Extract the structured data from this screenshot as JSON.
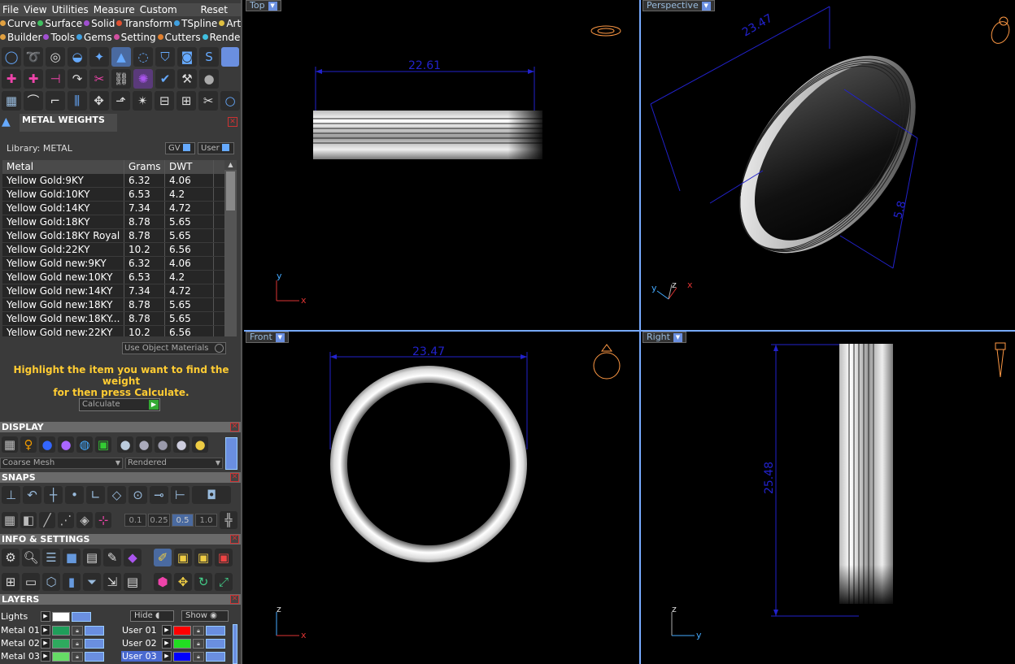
{
  "menu": {
    "file": "File",
    "view": "View",
    "utilities": "Utilities",
    "measure": "Measure",
    "custom": "Custom",
    "reset": "Reset"
  },
  "categories_row1": [
    {
      "label": "Curve",
      "color": "#e0a040"
    },
    {
      "label": "Surface",
      "color": "#40c060"
    },
    {
      "label": "Solid",
      "color": "#a050d0"
    },
    {
      "label": "Transform",
      "color": "#e05030"
    },
    {
      "label": "TSpline",
      "color": "#40a0e0"
    },
    {
      "label": "Art",
      "color": "#e0c040"
    }
  ],
  "categories_row2": [
    {
      "label": "Builder",
      "color": "#e0a040"
    },
    {
      "label": "Tools",
      "color": "#a050d0"
    },
    {
      "label": "Gems",
      "color": "#40a0e0"
    },
    {
      "label": "Setting",
      "color": "#d050a0"
    },
    {
      "label": "Cutters",
      "color": "#e08030"
    },
    {
      "label": "Render",
      "color": "#40c0e0"
    }
  ],
  "metal_weights": {
    "title": "METAL WEIGHTS",
    "library_label": "Library: METAL",
    "gv_label": "GV",
    "user_label": "User",
    "columns": [
      "Metal",
      "Grams",
      "DWT"
    ],
    "rows": [
      {
        "metal": "Yellow Gold:9KY",
        "grams": "6.32",
        "dwt": "4.06"
      },
      {
        "metal": "Yellow Gold:10KY",
        "grams": "6.53",
        "dwt": "4.2"
      },
      {
        "metal": "Yellow Gold:14KY",
        "grams": "7.34",
        "dwt": "4.72"
      },
      {
        "metal": "Yellow Gold:18KY",
        "grams": "8.78",
        "dwt": "5.65"
      },
      {
        "metal": "Yellow Gold:18KY Royal",
        "grams": "8.78",
        "dwt": "5.65"
      },
      {
        "metal": "Yellow Gold:22KY",
        "grams": "10.2",
        "dwt": "6.56"
      },
      {
        "metal": "Yellow Gold new:9KY",
        "grams": "6.32",
        "dwt": "4.06"
      },
      {
        "metal": "Yellow Gold new:10KY",
        "grams": "6.53",
        "dwt": "4.2"
      },
      {
        "metal": "Yellow Gold new:14KY",
        "grams": "7.34",
        "dwt": "4.72"
      },
      {
        "metal": "Yellow Gold new:18KY",
        "grams": "8.78",
        "dwt": "5.65"
      },
      {
        "metal": "Yellow Gold new:18KY...",
        "grams": "8.78",
        "dwt": "5.65"
      },
      {
        "metal": "Yellow Gold new:22KY",
        "grams": "10.2",
        "dwt": "6.56"
      }
    ],
    "use_object_materials": "Use Object Materials",
    "hint_line1": "Highlight the item you want to find the weight",
    "hint_line2": "for then press Calculate.",
    "calculate_label": "Calculate"
  },
  "display": {
    "title": "DISPLAY",
    "mesh_select": "Coarse Mesh",
    "render_select": "Rendered"
  },
  "snaps": {
    "title": "SNAPS",
    "values": [
      "0.1",
      "0.25",
      "0.5",
      "1.0"
    ]
  },
  "info_settings": {
    "title": "INFO & SETTINGS"
  },
  "layers": {
    "title": "LAYERS",
    "lights_label": "Lights",
    "hide_label": "Hide",
    "show_label": "Show",
    "left": [
      {
        "name": "Metal 01",
        "color": "#1f9e5a"
      },
      {
        "name": "Metal 02",
        "color": "#2eaa5e"
      },
      {
        "name": "Metal 03",
        "color": "#66dd66"
      }
    ],
    "right": [
      {
        "name": "User 01",
        "color": "#ff0000"
      },
      {
        "name": "User 02",
        "color": "#22dd22"
      },
      {
        "name": "User 03",
        "color": "#0000ff"
      }
    ]
  },
  "viewports": {
    "top": {
      "label": "Top",
      "dim": "22.61",
      "axis_v": "y",
      "axis_h": "x"
    },
    "perspective": {
      "label": "Perspective",
      "dim1": "23.47",
      "dim2": "5.8",
      "axis_a": "y",
      "axis_b": "z",
      "axis_c": "x"
    },
    "front": {
      "label": "Front",
      "dim": "23.47",
      "axis_v": "z",
      "axis_h": "x"
    },
    "right": {
      "label": "Right",
      "dim": "25.48",
      "axis_v": "z",
      "axis_h": "y"
    }
  }
}
